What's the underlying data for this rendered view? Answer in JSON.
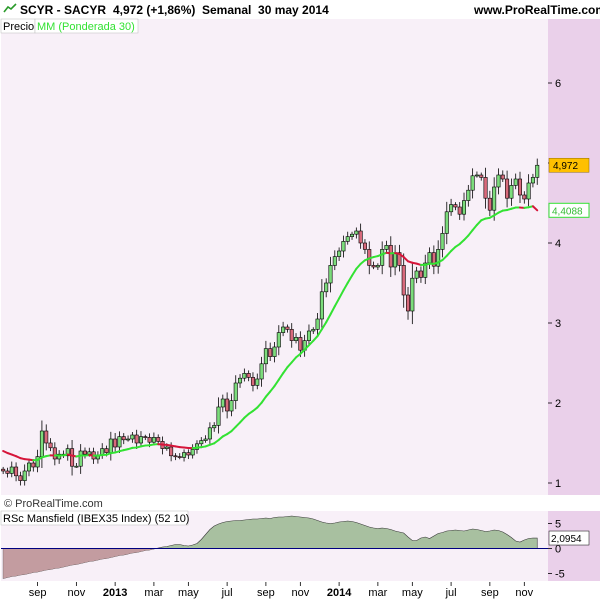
{
  "header": {
    "title": "SCYR - SACYR",
    "price": "4,972 (+1,86%)",
    "period": "Semanal  30 may 2014",
    "site": "www.ProRealTime.com"
  },
  "legend": {
    "price": "Precio",
    "ma": "MM (Ponderada 30)"
  },
  "copyright": "© ProRealTime.com",
  "colors": {
    "background": "#ffffff",
    "main_panel_bg": "#f8f0f8",
    "axis_panel_bg": "#ead0ea",
    "up_candle": "#7cdc7c",
    "down_candle": "#d86a7c",
    "ma_up": "#33e233",
    "ma_down": "#d6153a",
    "mansfield_fill": "#a8c0a0",
    "mansfield_negative_fill": "#c39ca0",
    "zero_line": "#000080"
  },
  "chart_data": [
    {
      "type": "candlestick",
      "title": "SCYR - SACYR",
      "ylim": [
        0.85,
        6.8
      ],
      "y_ticks": [
        "6",
        "5",
        "4",
        "3",
        "2",
        "1"
      ],
      "tick_values": [
        6,
        5,
        4,
        3,
        2,
        1
      ],
      "x_ticks": [
        "sep",
        "nov",
        "2013",
        "mar",
        "may",
        "jul",
        "sep",
        "nov",
        "2014",
        "mar",
        "may",
        "jul",
        "sep",
        "nov"
      ],
      "x_tick_weeks": [
        8,
        17,
        26,
        35,
        43,
        52,
        61,
        69,
        78,
        87,
        95,
        104,
        113,
        121
      ],
      "weeks": 125,
      "last_price_label": "4,972",
      "last_price": 4.972,
      "ma_label": "4,4088",
      "ma_value": 4.4088,
      "close": [
        1.15,
        1.12,
        1.2,
        1.09,
        1.03,
        1.15,
        1.25,
        1.2,
        1.33,
        1.65,
        1.5,
        1.44,
        1.3,
        1.36,
        1.34,
        1.43,
        1.21,
        1.21,
        1.4,
        1.36,
        1.39,
        1.3,
        1.35,
        1.43,
        1.38,
        1.55,
        1.45,
        1.58,
        1.54,
        1.55,
        1.6,
        1.5,
        1.58,
        1.57,
        1.51,
        1.57,
        1.52,
        1.43,
        1.45,
        1.34,
        1.33,
        1.32,
        1.38,
        1.35,
        1.42,
        1.49,
        1.53,
        1.55,
        1.69,
        1.72,
        1.95,
        2.05,
        1.9,
        2.03,
        2.25,
        2.31,
        2.37,
        2.32,
        2.22,
        2.3,
        2.49,
        2.68,
        2.58,
        2.7,
        2.88,
        2.95,
        2.92,
        2.78,
        2.82,
        2.66,
        2.78,
        2.9,
        2.92,
        3.05,
        3.39,
        3.5,
        3.72,
        3.83,
        3.9,
        4.02,
        4.08,
        4.11,
        4.15,
        4.0,
        3.92,
        3.72,
        3.7,
        3.72,
        3.92,
        3.97,
        3.7,
        3.88,
        3.72,
        3.35,
        3.15,
        3.56,
        3.65,
        3.57,
        3.75,
        3.88,
        3.71,
        3.92,
        4.12,
        4.39,
        4.48,
        4.45,
        4.36,
        4.53,
        4.66,
        4.84,
        4.85,
        4.82,
        4.56,
        4.41,
        4.7,
        4.85,
        4.8,
        4.56,
        4.72,
        4.8,
        4.6,
        4.55,
        4.75,
        4.82,
        4.972
      ],
      "ma": [
        1.4,
        1.375,
        1.356,
        1.335,
        1.311,
        1.298,
        1.292,
        1.284,
        1.287,
        1.32,
        1.336,
        1.346,
        1.343,
        1.345,
        1.346,
        1.356,
        1.343,
        1.331,
        1.343,
        1.344,
        1.348,
        1.342,
        1.342,
        1.35,
        1.353,
        1.374,
        1.381,
        1.398,
        1.411,
        1.423,
        1.439,
        1.443,
        1.458,
        1.468,
        1.472,
        1.482,
        1.486,
        1.48,
        1.477,
        1.467,
        1.458,
        1.449,
        1.444,
        1.437,
        1.436,
        1.441,
        1.449,
        1.457,
        1.477,
        1.496,
        1.536,
        1.582,
        1.611,
        1.648,
        1.702,
        1.757,
        1.815,
        1.863,
        1.9,
        1.943,
        2.003,
        2.079,
        2.143,
        2.211,
        2.291,
        2.372,
        2.448,
        2.508,
        2.57,
        2.614,
        2.666,
        2.723,
        2.777,
        2.837,
        2.922,
        3.009,
        3.108,
        3.209,
        3.307,
        3.407,
        3.502,
        3.592,
        3.678,
        3.739,
        3.784,
        3.807,
        3.824,
        3.837,
        3.858,
        3.878,
        3.87,
        3.873,
        3.864,
        3.824,
        3.771,
        3.753,
        3.742,
        3.726,
        3.727,
        3.74,
        3.74,
        3.756,
        3.787,
        3.84,
        3.9,
        3.951,
        3.987,
        4.037,
        4.093,
        4.161,
        4.226,
        4.284,
        4.305,
        4.315,
        4.345,
        4.379,
        4.405,
        4.412,
        4.428,
        4.443,
        4.443,
        4.439,
        4.447,
        4.459,
        4.4088
      ]
    },
    {
      "type": "area",
      "title": "RSc Mansfield (IBEX35 Index) (52 10)",
      "ylim": [
        -6.5,
        7.5
      ],
      "y_ticks": [
        "5",
        "0",
        "-5"
      ],
      "tick_values": [
        5,
        0,
        -5
      ],
      "last_value_label": "2,0954",
      "last_value": 2.0954,
      "values": [
        -6.0,
        -5.8,
        -5.6,
        -5.5,
        -5.3,
        -5.2,
        -5.0,
        -4.8,
        -4.7,
        -4.5,
        -4.3,
        -4.2,
        -4.0,
        -3.9,
        -3.7,
        -3.5,
        -3.3,
        -3.2,
        -3.0,
        -2.8,
        -2.6,
        -2.5,
        -2.3,
        -2.1,
        -2.0,
        -1.8,
        -1.6,
        -1.4,
        -1.3,
        -1.1,
        -0.9,
        -0.8,
        -0.6,
        -0.4,
        -0.3,
        -0.1,
        0.1,
        0.3,
        0.4,
        0.6,
        0.8,
        0.8,
        0.6,
        0.5,
        0.7,
        1.0,
        1.8,
        2.8,
        3.8,
        4.5,
        4.9,
        5.2,
        5.4,
        5.5,
        5.6,
        5.6,
        5.7,
        5.8,
        5.9,
        5.9,
        6.0,
        6.1,
        6.0,
        6.2,
        6.3,
        6.3,
        6.4,
        6.5,
        6.4,
        6.3,
        6.2,
        6.1,
        5.9,
        5.6,
        5.3,
        5.1,
        5.0,
        5.1,
        5.3,
        5.4,
        5.5,
        5.4,
        5.2,
        4.9,
        4.6,
        4.3,
        4.1,
        4.0,
        4.1,
        4.0,
        3.8,
        3.5,
        3.3,
        3.1,
        2.3,
        1.6,
        1.6,
        2.1,
        2.3,
        2.0,
        2.5,
        3.0,
        3.2,
        3.5,
        3.6,
        3.7,
        3.6,
        3.5,
        3.7,
        3.9,
        3.8,
        3.6,
        3.4,
        3.5,
        3.7,
        3.6,
        3.3,
        2.8,
        2.2,
        1.5,
        1.3,
        1.7,
        2.0,
        2.1,
        2.0954
      ]
    }
  ]
}
